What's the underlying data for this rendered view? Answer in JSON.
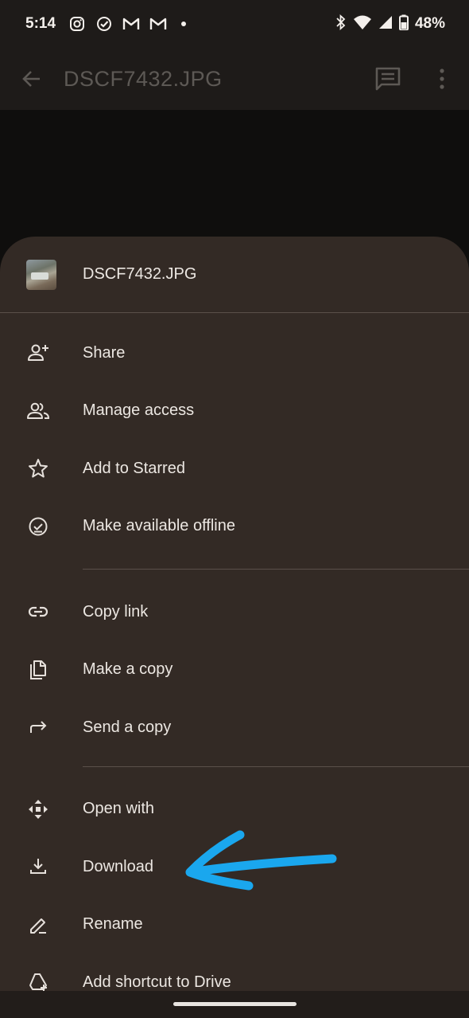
{
  "status_bar": {
    "time": "5:14",
    "battery": "48%"
  },
  "app_bar": {
    "title": "DSCF7432.JPG"
  },
  "sheet": {
    "filename": "DSCF7432.JPG",
    "groups": [
      [
        {
          "label": "Share",
          "icon": "person-add-icon"
        },
        {
          "label": "Manage access",
          "icon": "people-icon"
        },
        {
          "label": "Add to Starred",
          "icon": "star-icon"
        },
        {
          "label": "Make available offline",
          "icon": "offline-check-icon"
        }
      ],
      [
        {
          "label": "Copy link",
          "icon": "link-icon"
        },
        {
          "label": "Make a copy",
          "icon": "copy-icon"
        },
        {
          "label": "Send a copy",
          "icon": "forward-icon"
        }
      ],
      [
        {
          "label": "Open with",
          "icon": "open-with-icon"
        },
        {
          "label": "Download",
          "icon": "download-icon"
        },
        {
          "label": "Rename",
          "icon": "pencil-icon"
        },
        {
          "label": "Add shortcut to Drive",
          "icon": "drive-shortcut-icon"
        }
      ]
    ]
  },
  "colors": {
    "sheet_bg": "#332a25",
    "text": "#ece7e2",
    "annotation": "#1aa7ee"
  }
}
